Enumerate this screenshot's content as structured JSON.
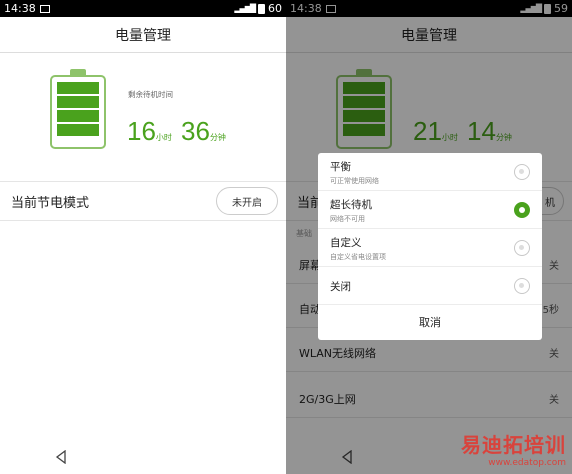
{
  "left": {
    "status": {
      "time": "14:38",
      "battery": "60"
    },
    "title": "电量管理",
    "remaining_label": "剩余待机时间",
    "hours": "16",
    "hours_unit": "小时",
    "minutes": "36",
    "minutes_unit": "分钟",
    "mode_label": "当前节电模式",
    "mode_button": "未开启"
  },
  "right": {
    "status": {
      "time": "14:38",
      "battery": "59"
    },
    "title": "电量管理",
    "hours": "21",
    "hours_unit": "小时",
    "minutes": "14",
    "minutes_unit": "分钟",
    "mode_label_partial": "当前",
    "mode_button_partial": "机",
    "section_header": "基础",
    "rows": [
      {
        "label": "屏幕",
        "value": "关"
      },
      {
        "label": "自动",
        "value": "5秒"
      },
      {
        "label": "WLAN无线网络",
        "value": "关"
      },
      {
        "label": "2G/3G上网",
        "value": "关"
      }
    ],
    "dialog": {
      "options": [
        {
          "title": "平衡",
          "subtitle": "可正常使用网络",
          "selected": false
        },
        {
          "title": "超长待机",
          "subtitle": "网络不可用",
          "selected": true
        },
        {
          "title": "自定义",
          "subtitle": "自定义省电设置项",
          "selected": false
        },
        {
          "title": "关闭",
          "subtitle": "",
          "selected": false
        }
      ],
      "cancel": "取消"
    }
  },
  "battery_level": 0.8,
  "colors": {
    "accent": "#4aa21d",
    "battery_outline": "#8ec36a"
  },
  "watermark": {
    "brand": "易迪拓培训",
    "url": "www.edatop.com"
  }
}
